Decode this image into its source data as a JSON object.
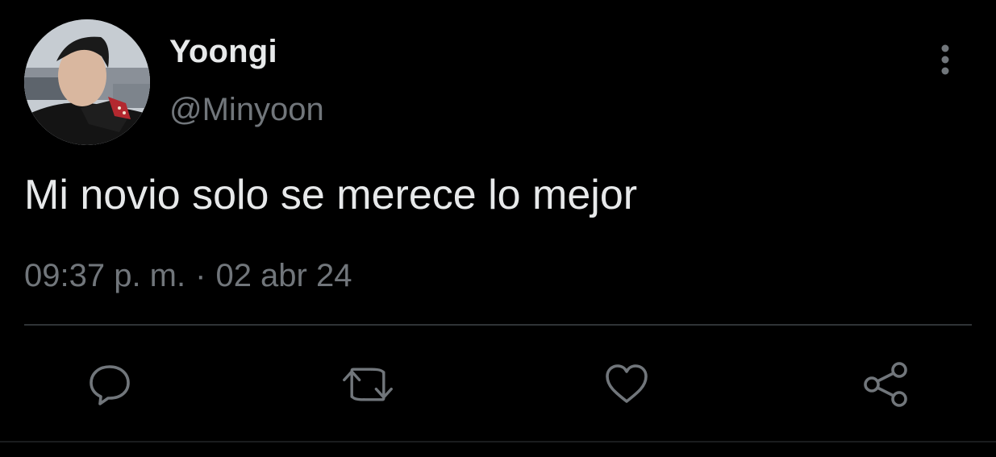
{
  "tweet": {
    "display_name": "Yoongi",
    "handle": "@Minyoon",
    "text": "Mi novio solo se merece lo mejor",
    "time": "09:37 p. m.",
    "separator": "·",
    "date": "02 abr 24"
  },
  "actions": [
    {
      "name": "reply",
      "icon": "speech-bubble-icon"
    },
    {
      "name": "retweet",
      "icon": "retweet-icon"
    },
    {
      "name": "like",
      "icon": "heart-icon"
    },
    {
      "name": "share",
      "icon": "share-nodes-icon"
    }
  ],
  "colors": {
    "background": "#000000",
    "primary_text": "#e7e9ea",
    "secondary_text": "#71767b",
    "divider": "#2f3336"
  }
}
